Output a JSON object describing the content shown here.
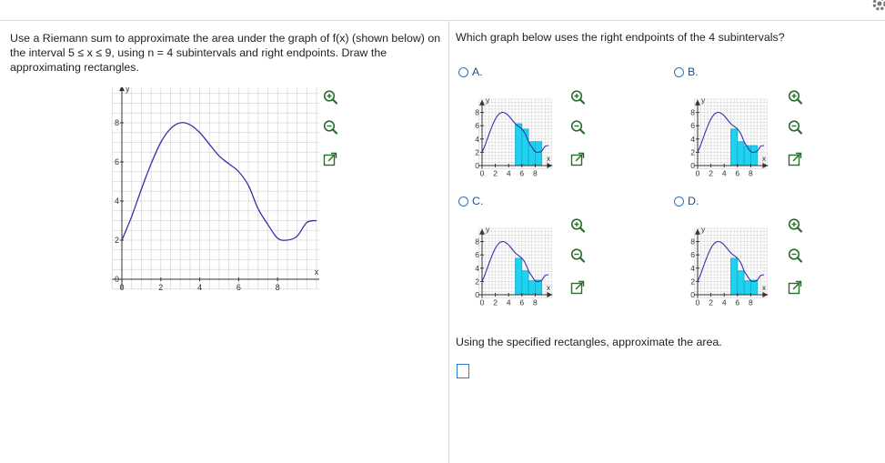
{
  "question": {
    "text": "Use a Riemann sum to approximate the area under the graph of f(x) (shown below) on the interval 5 ≤ x ≤ 9, using n = 4 subintervals and right endpoints. Draw the approximating rectangles."
  },
  "right_panel": {
    "question": "Which graph below uses the right endpoints of the 4 subintervals?",
    "instruction": "Using the specified rectangles, approximate the area.",
    "answer_value": ""
  },
  "main_graph": {
    "x_axis_label": "x",
    "y_axis_label": "y",
    "x_ticks": [
      "0",
      "2",
      "4",
      "6",
      "8"
    ],
    "y_ticks": [
      "0",
      "2",
      "4",
      "6",
      "8"
    ]
  },
  "thumb_graph": {
    "x_axis_label": "x",
    "y_axis_label": "y",
    "x_ticks": [
      "0",
      "2",
      "4",
      "6",
      "8"
    ],
    "y_ticks": [
      "0",
      "2",
      "4",
      "6",
      "8"
    ]
  },
  "options": [
    {
      "letter": "A.",
      "selected": false
    },
    {
      "letter": "B.",
      "selected": false
    },
    {
      "letter": "C.",
      "selected": false
    },
    {
      "letter": "D.",
      "selected": false
    }
  ],
  "curve": {
    "color": "#3333aa",
    "points": [
      [
        0,
        2
      ],
      [
        0.5,
        3.2
      ],
      [
        1,
        4.6
      ],
      [
        1.5,
        5.9
      ],
      [
        2,
        7.0
      ],
      [
        2.5,
        7.7
      ],
      [
        3,
        8.0
      ],
      [
        3.5,
        7.9
      ],
      [
        4,
        7.5
      ],
      [
        4.5,
        6.9
      ],
      [
        5,
        6.3
      ],
      [
        5.5,
        5.9
      ],
      [
        6,
        5.5
      ],
      [
        6.5,
        4.8
      ],
      [
        7,
        3.6
      ],
      [
        7.5,
        2.8
      ],
      [
        8,
        2.1
      ],
      [
        8.5,
        2.0
      ],
      [
        9,
        2.2
      ],
      [
        9.5,
        2.9
      ],
      [
        10,
        3.0
      ]
    ]
  },
  "rect_color": "#1fd2f0",
  "option_rects": {
    "A": [
      [
        5,
        6,
        6.3
      ],
      [
        6,
        7,
        5.5
      ],
      [
        7,
        8,
        3.6
      ],
      [
        8,
        9,
        3.6
      ]
    ],
    "B": [
      [
        5,
        6,
        5.5
      ],
      [
        6,
        7,
        3.6
      ],
      [
        7,
        8,
        3.0
      ],
      [
        8,
        9,
        3.0
      ]
    ],
    "C": [
      [
        5,
        6,
        5.5
      ],
      [
        6,
        7,
        3.6
      ],
      [
        7,
        8,
        2.1
      ],
      [
        8,
        9,
        2.2
      ]
    ],
    "D": [
      [
        5,
        6,
        5.5
      ],
      [
        6,
        7,
        3.6
      ],
      [
        7,
        8,
        2.1
      ],
      [
        8,
        9,
        2.2
      ]
    ]
  },
  "icons": {
    "zoom_in": "zoom-in-icon",
    "zoom_out": "zoom-out-icon",
    "popout": "popout-icon",
    "settings": "gear-icon"
  }
}
